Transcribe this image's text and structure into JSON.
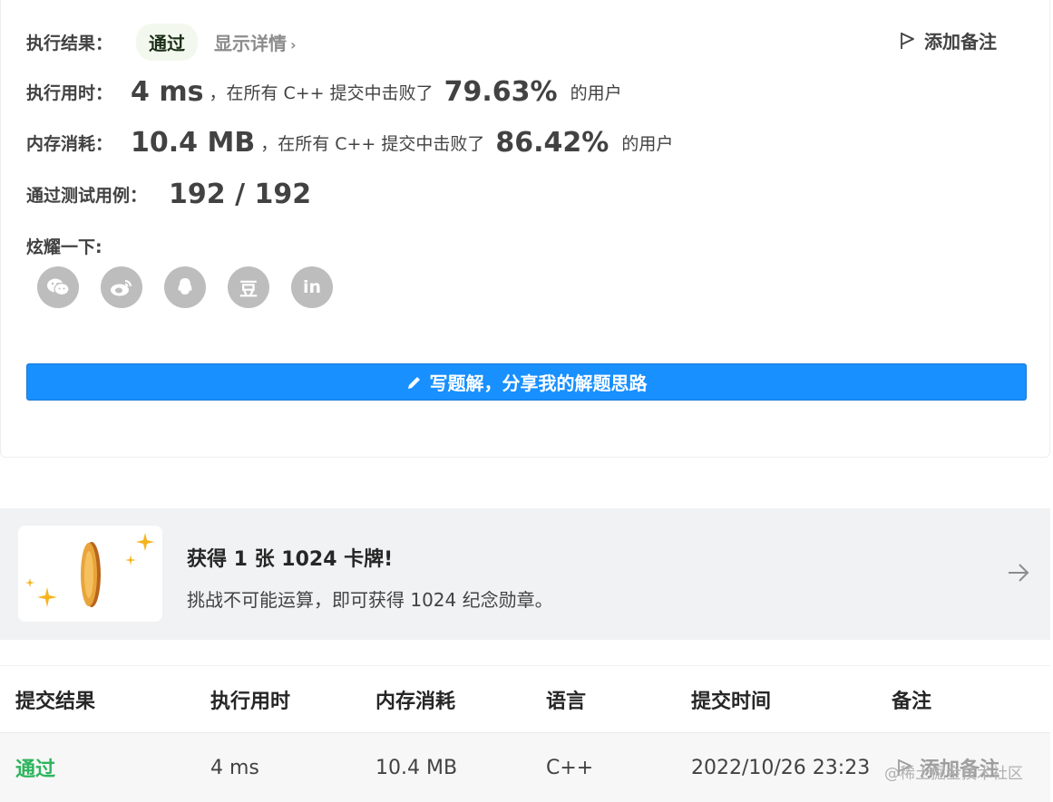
{
  "result": {
    "label": "执行结果：",
    "status": "通过",
    "details_link": "显示详情",
    "add_note": "添加备注"
  },
  "runtime": {
    "label": "执行用时：",
    "value": "4 ms",
    "mid_text": "，在所有 C++ 提交中击败了",
    "percent": "79.63%",
    "suffix": "的用户"
  },
  "memory": {
    "label": "内存消耗：",
    "value": "10.4 MB",
    "mid_text": "，在所有 C++ 提交中击败了",
    "percent": "86.42%",
    "suffix": "的用户"
  },
  "testcases": {
    "label": "通过测试用例：",
    "value": "192 / 192"
  },
  "share": {
    "label": "炫耀一下:",
    "icons": [
      "wechat-icon",
      "weibo-icon",
      "qq-icon",
      "douban-icon",
      "linkedin-icon"
    ],
    "douban_glyph": "豆",
    "linkedin_glyph": "in"
  },
  "write_solution": {
    "label": "写题解，分享我的解题思路"
  },
  "promo": {
    "title": "获得 1 张 1024 卡牌!",
    "subtitle": "挑战不可能运算，即可获得 1024 纪念勋章。"
  },
  "table": {
    "headers": [
      "提交结果",
      "执行用时",
      "内存消耗",
      "语言",
      "提交时间",
      "备注"
    ],
    "rows": [
      {
        "result": "通过",
        "runtime": "4 ms",
        "memory": "10.4 MB",
        "language": "C++",
        "time": "2022/10/26 23:23",
        "note": "添加备注"
      }
    ]
  },
  "watermark": "@稀土掘金技术社区",
  "colors": {
    "accent": "#1890ff",
    "success": "#2db55d",
    "promo_bg": "#f1f2f4"
  }
}
